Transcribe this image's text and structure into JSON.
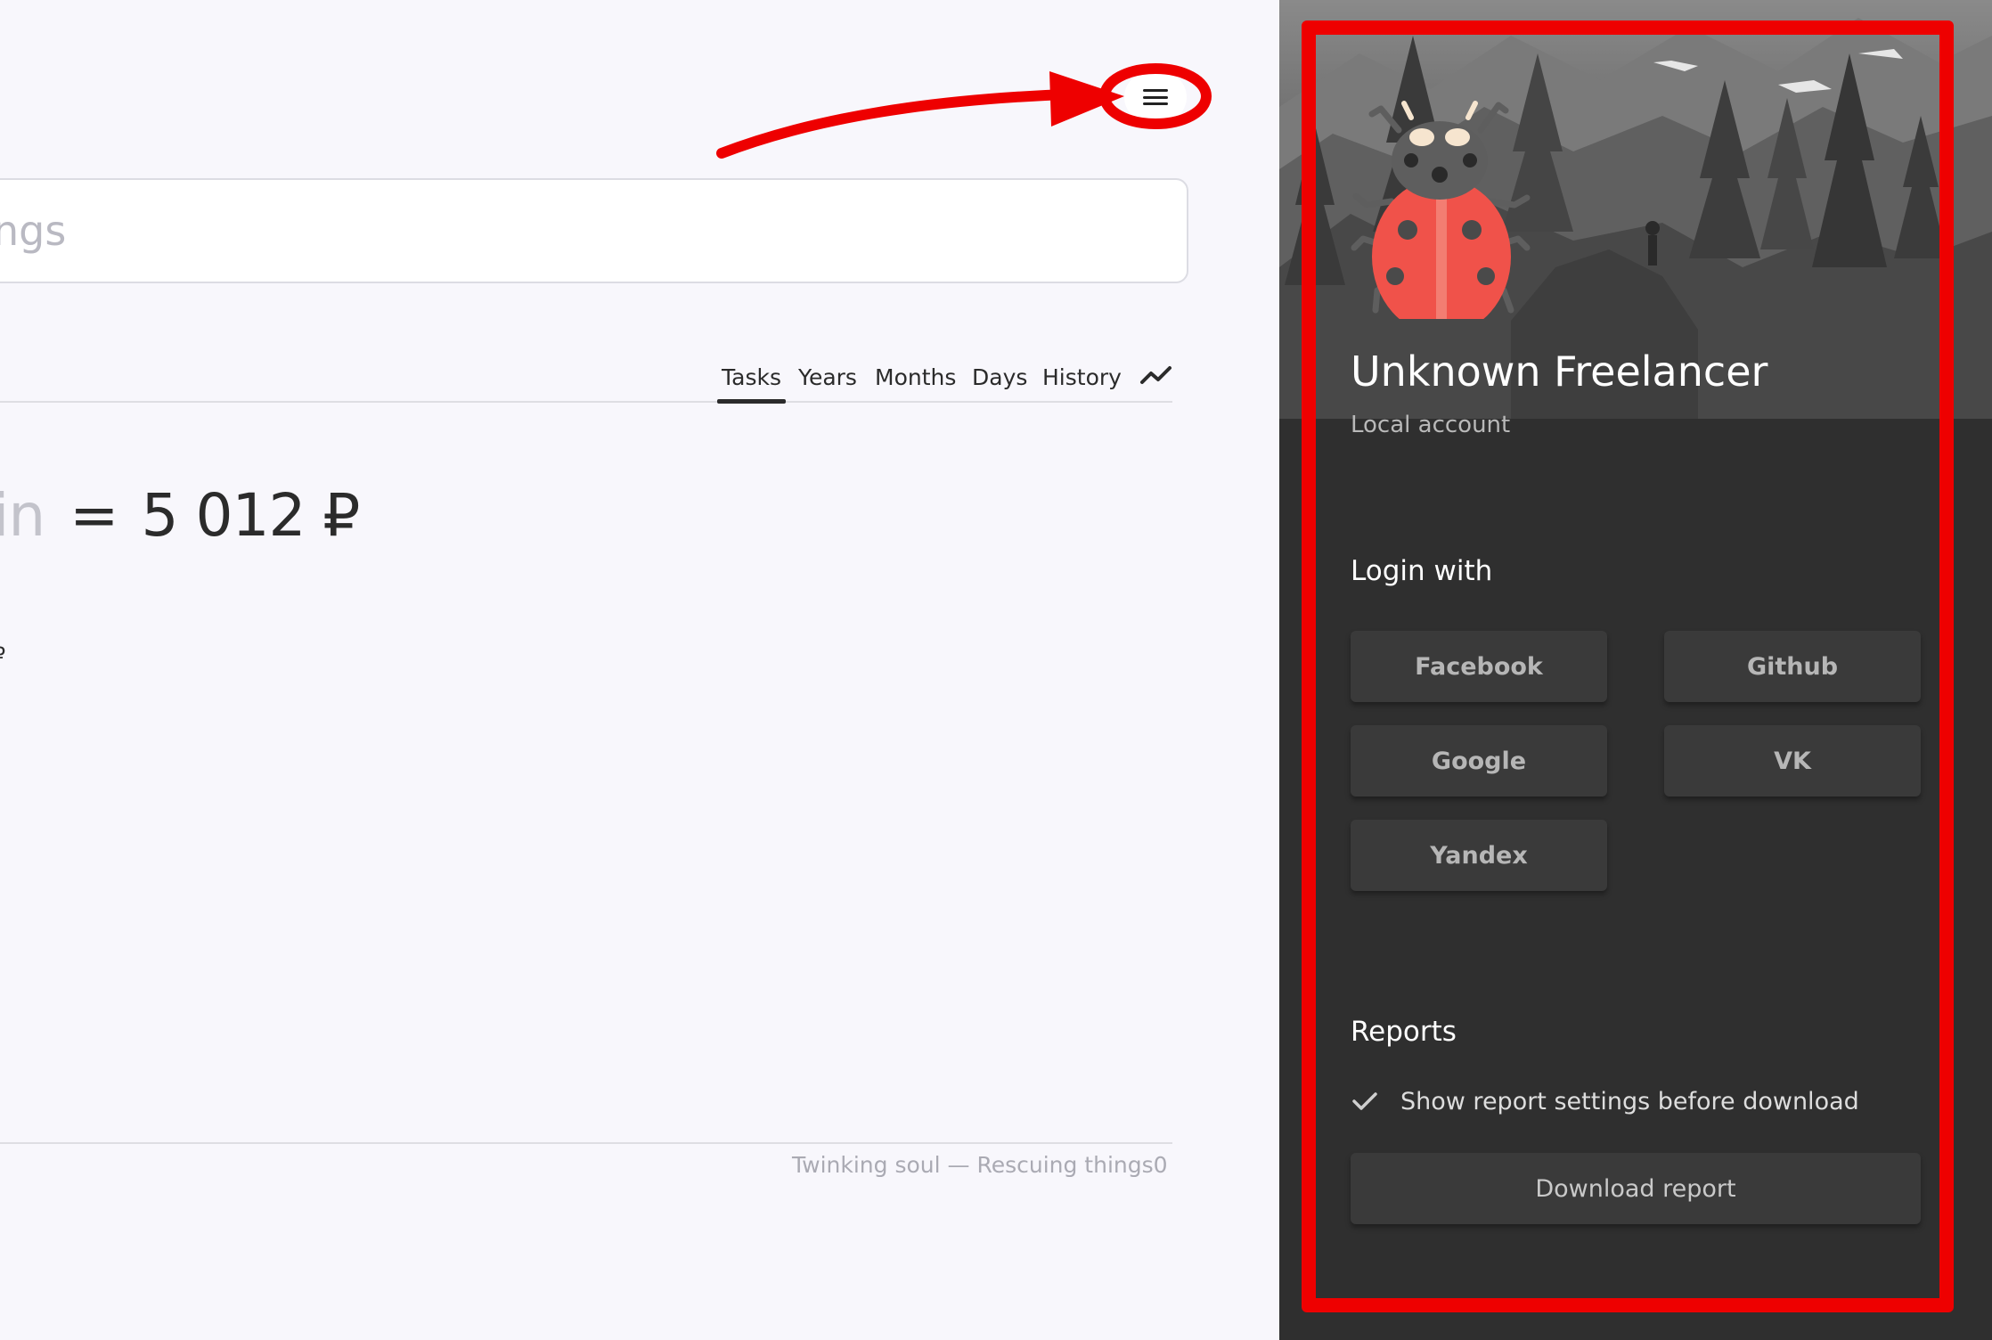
{
  "colors": {
    "page_bg": "#f8f7fc",
    "panel_bg": "#2f2f2f",
    "annotation_red": "#ee0000",
    "ladybug_red": "#f0524a",
    "text_dark": "#2b2b2b",
    "text_muted": "#aaaab3"
  },
  "header": {
    "menu_icon": "hamburger-menu-icon"
  },
  "search": {
    "placeholder": "ngs"
  },
  "tabs": [
    {
      "label": "Tasks",
      "active": true
    },
    {
      "label": "Years",
      "active": false
    },
    {
      "label": "Months",
      "active": false
    },
    {
      "label": "Days",
      "active": false
    },
    {
      "label": "History",
      "active": false
    }
  ],
  "tabs_trend_icon": "trending-icon",
  "summary": {
    "unit_fragment": "in",
    "equals": "=",
    "total": "5 012 ₽",
    "stray_char": "₽"
  },
  "footer": {
    "text": "Twinking soul — Rescuing things0"
  },
  "panel": {
    "avatar_icon": "ladybug-icon",
    "user_name": "Unknown Freelancer",
    "account_type": "Local account",
    "login_title": "Login with",
    "login_buttons": [
      "Facebook",
      "Github",
      "Google",
      "VK",
      "Yandex"
    ],
    "reports_title": "Reports",
    "report_option": "Show report settings before download",
    "report_option_checked": true,
    "check_icon": "checkmark-icon",
    "download_button": "Download report"
  }
}
